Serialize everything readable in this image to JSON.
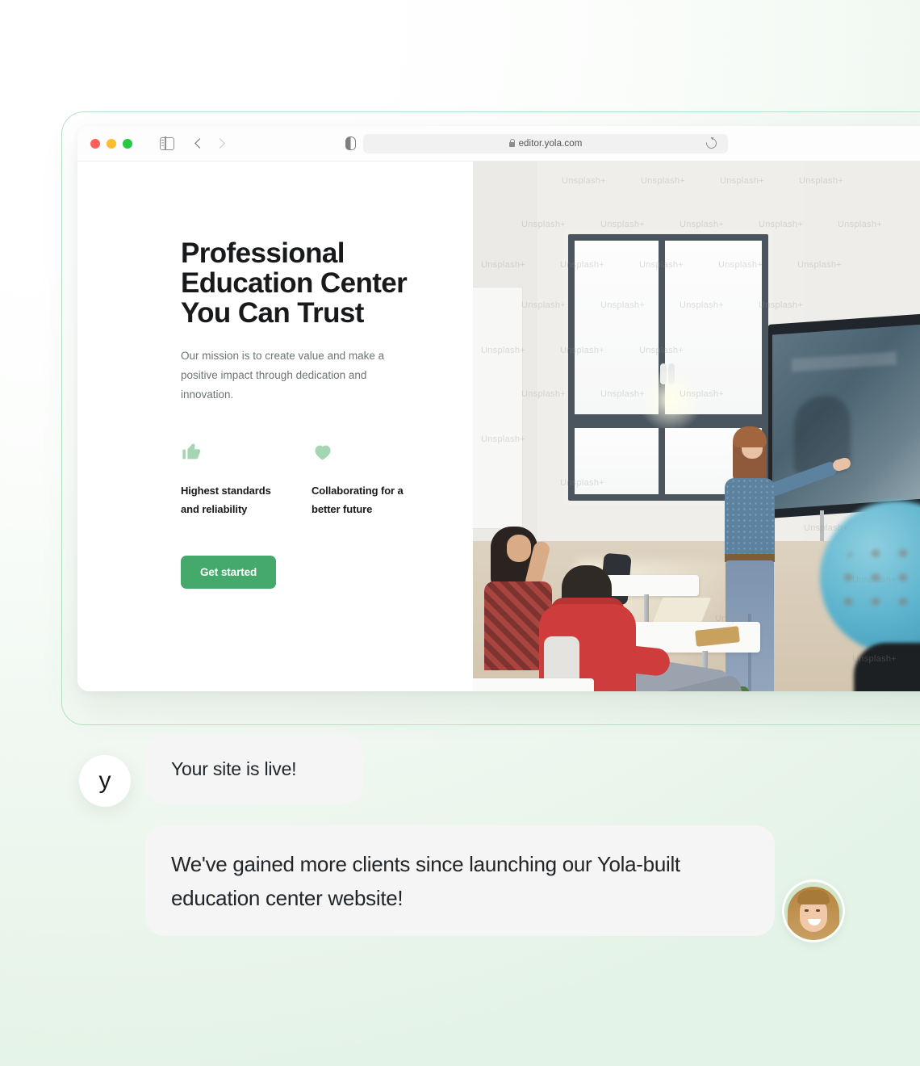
{
  "browser": {
    "traffic_lights": [
      "close",
      "minimize",
      "maximize"
    ],
    "sidebar_toggle": "sidebar-toggle",
    "back_label": "Back",
    "forward_label": "Forward",
    "shield_label": "Privacy Report",
    "url": "editor.yola.com",
    "lock": "secure",
    "reload_label": "Reload"
  },
  "hero": {
    "title": "Professional Education Center You Can Trust",
    "subtitle": "Our mission is to create value and make a positive impact through dedication and innovation.",
    "features": [
      {
        "icon": "thumbs-up-icon",
        "label": "Highest standards and reliability"
      },
      {
        "icon": "heart-icon",
        "label": "Collaborating for a better future"
      }
    ],
    "cta_label": "Get started",
    "photo_alt": "classroom-photo",
    "photo_watermark": "Unsplash+"
  },
  "chat": {
    "brand_initial": "y",
    "messages": [
      {
        "text": "Your site is live!",
        "from": "yola"
      },
      {
        "text": "We've gained more clients since launching our Yola-built education center website!",
        "from": "client"
      }
    ],
    "client_avatar_alt": "client-portrait"
  },
  "colors": {
    "accent_green": "#45a96b",
    "icon_green": "#a5d6b4",
    "frame_green": "#b6e3c3",
    "bubble_gray": "#f4f5f4",
    "text_dark": "#17191b",
    "text_muted": "#6d7472"
  }
}
